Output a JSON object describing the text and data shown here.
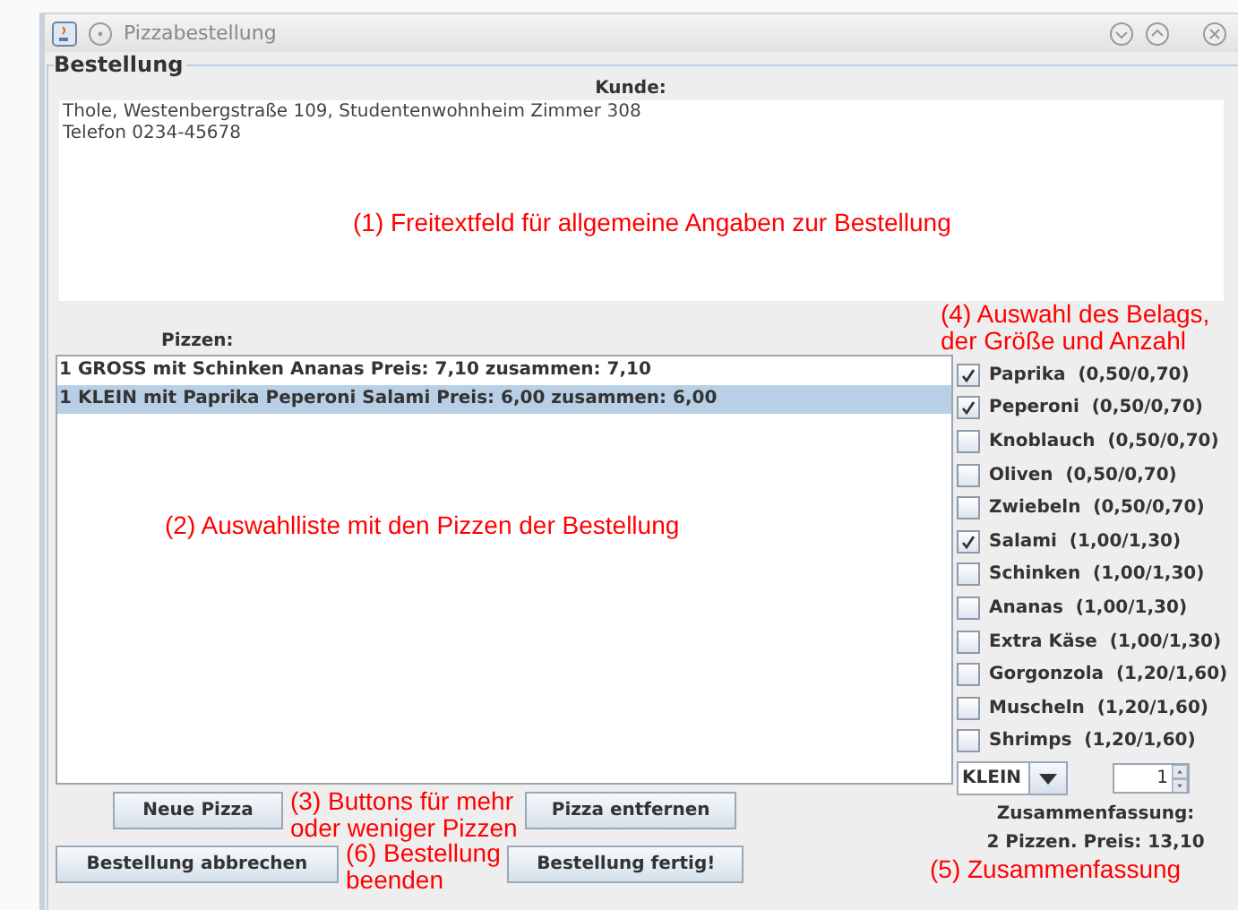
{
  "window": {
    "title": "Pizzabestellung"
  },
  "panel": {
    "title": "Bestellung"
  },
  "customer": {
    "label": "Kunde:",
    "lines": [
      "Thole, Westenbergstraße 109, Studentenwohnheim Zimmer 308",
      "Telefon 0234-45678"
    ],
    "annotation": [
      "(1) Freitextfeld für allgemeine Angaben zur Bestellung"
    ]
  },
  "pizzas": {
    "label": "Pizzen:",
    "annotation": [
      "(2) Auswahlliste mit den Pizzen der Bestellung"
    ],
    "items": [
      {
        "text": "1 GROSS mit Schinken Ananas  Preis: 7,10 zusammen: 7,10",
        "selected": false
      },
      {
        "text": "1 KLEIN mit Paprika Peperoni Salami  Preis: 6,00 zusammen: 6,00",
        "selected": true
      }
    ]
  },
  "toppings_annotation": [
    "(4) Auswahl des Belags,",
    "der Größe und Anzahl"
  ],
  "toppings": [
    {
      "name": "Paprika",
      "price": "(0,50/0,70)",
      "checked": true
    },
    {
      "name": "Peperoni",
      "price": "(0,50/0,70)",
      "checked": true
    },
    {
      "name": "Knoblauch",
      "price": "(0,50/0,70)",
      "checked": false
    },
    {
      "name": "Oliven",
      "price": "(0,50/0,70)",
      "checked": false
    },
    {
      "name": "Zwiebeln",
      "price": "(0,50/0,70)",
      "checked": false
    },
    {
      "name": "Salami",
      "price": "(1,00/1,30)",
      "checked": true
    },
    {
      "name": "Schinken",
      "price": "(1,00/1,30)",
      "checked": false
    },
    {
      "name": "Ananas",
      "price": "(1,00/1,30)",
      "checked": false
    },
    {
      "name": "Extra Käse",
      "price": "(1,00/1,30)",
      "checked": false
    },
    {
      "name": "Gorgonzola",
      "price": "(1,20/1,60)",
      "checked": false
    },
    {
      "name": "Muscheln",
      "price": "(1,20/1,60)",
      "checked": false
    },
    {
      "name": "Shrimps",
      "price": "(1,20/1,60)",
      "checked": false
    }
  ],
  "size": {
    "value": "KLEIN"
  },
  "quantity": {
    "value": "1"
  },
  "pizza_buttons": {
    "add": "Neue Pizza",
    "remove": "Pizza entfernen",
    "annotation": [
      "(3) Buttons für mehr",
      "oder weniger Pizzen"
    ]
  },
  "order_buttons": {
    "cancel": "Bestellung abbrechen",
    "finish": "Bestellung fertig!",
    "annotation": [
      "(6) Bestellung",
      "beenden"
    ]
  },
  "summary": {
    "label": "Zusammenfassung:",
    "text": "2 Pizzen. Preis: 13,10",
    "annotation": [
      "(5) Zusammenfassung"
    ]
  }
}
